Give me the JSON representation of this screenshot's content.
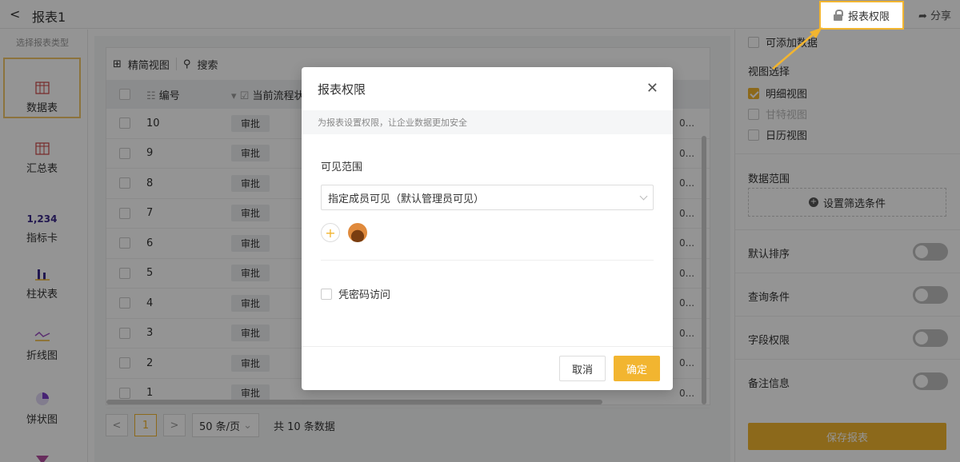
{
  "topbar": {
    "back": "<",
    "title": "报表1",
    "perm_label": "报表权限",
    "share_label": "分享"
  },
  "left": {
    "heading": "选择报表类型",
    "items": [
      {
        "label": "数据表",
        "icon": "table-icon"
      },
      {
        "label": "汇总表",
        "icon": "summary-table-icon"
      },
      {
        "label": "指标卡",
        "icon": "metric-card-icon",
        "value": "1,234"
      },
      {
        "label": "柱状表",
        "icon": "bar-chart-icon"
      },
      {
        "label": "折线图",
        "icon": "line-chart-icon"
      },
      {
        "label": "饼状图",
        "icon": "pie-chart-icon"
      }
    ]
  },
  "table": {
    "view_label": "精简视图",
    "search_label": "搜索",
    "col_num": "编号",
    "col_flow": "当前流程状",
    "rows": [
      {
        "num": "10",
        "flow": "审批",
        "right": "0..."
      },
      {
        "num": "9",
        "flow": "审批",
        "right": "0..."
      },
      {
        "num": "8",
        "flow": "审批",
        "right": "0..."
      },
      {
        "num": "7",
        "flow": "审批",
        "right": "0..."
      },
      {
        "num": "6",
        "flow": "审批",
        "right": "0..."
      },
      {
        "num": "5",
        "flow": "审批",
        "right": "0..."
      },
      {
        "num": "4",
        "flow": "审批",
        "right": "0..."
      },
      {
        "num": "3",
        "flow": "审批",
        "right": "0..."
      },
      {
        "num": "2",
        "flow": "审批",
        "right": "0..."
      },
      {
        "num": "1",
        "flow": "审批",
        "right": "0..."
      }
    ],
    "pager": {
      "prev": "<",
      "page": "1",
      "next": ">",
      "size": "50 条/页",
      "total": "共 10 条数据"
    }
  },
  "right": {
    "add_data": "可添加数据",
    "view_select": "视图选择",
    "views": [
      {
        "label": "明细视图",
        "checked": true
      },
      {
        "label": "甘特视图",
        "checked": false
      },
      {
        "label": "日历视图",
        "checked": false
      }
    ],
    "data_range": "数据范围",
    "filter_label": "设置筛选条件",
    "toggles": [
      "默认排序",
      "查询条件",
      "字段权限",
      "备注信息"
    ],
    "save_label": "保存报表"
  },
  "modal": {
    "title": "报表权限",
    "tip": "为报表设置权限，让企业数据更加安全",
    "visible_label": "可见范围",
    "visible_value": "指定成员可见（默认管理员可见）",
    "password_label": "凭密码访问",
    "cancel": "取消",
    "ok": "确定"
  },
  "colors": {
    "accent": "#f2b530"
  }
}
